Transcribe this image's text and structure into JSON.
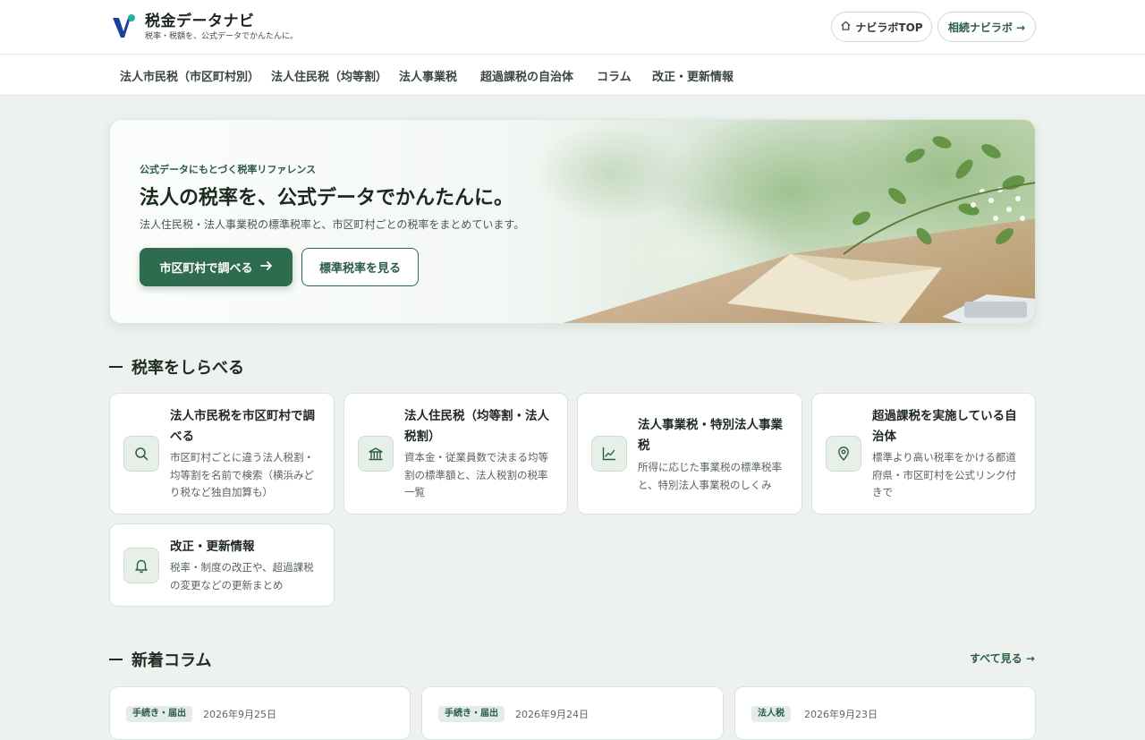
{
  "header": {
    "site_name": "税金データナビ",
    "tagline": "税率・税額を、公式データでかんたんに。",
    "top_link": "ナビラボTOP",
    "souzoku_link": "相続ナビラボ →"
  },
  "nav": {
    "items": [
      "法人市民税（市区町村別）",
      "法人住民税（均等割）",
      "法人事業税",
      "超過課税の自治体",
      "コラム",
      "改正・更新情報"
    ]
  },
  "hero": {
    "eyebrow": "公式データにもとづく税率リファレンス",
    "title": "法人の税率を、公式データでかんたんに。",
    "subtitle": "法人住民税・法人事業税の標準税率と、市区町村ごとの税率をまとめています。",
    "primary_button": "市区町村で調べる",
    "secondary_button": "標準税率を見る"
  },
  "lookup": {
    "section_title": "税率をしらべる",
    "cards": [
      {
        "title": "法人市民税を市区町村で調べる",
        "desc": "市区町村ごとに違う法人税割・均等割を名前で検索（横浜みどり税など独自加算も）",
        "icon": "search-icon"
      },
      {
        "title": "法人住民税（均等割・法人税割）",
        "desc": "資本金・従業員数で決まる均等割の標準額と、法人税割の税率一覧",
        "icon": "building-icon"
      },
      {
        "title": "法人事業税・特別法人事業税",
        "desc": "所得に応じた事業税の標準税率と、特別法人事業税のしくみ",
        "icon": "chart-line-icon"
      },
      {
        "title": "超過課税を実施している自治体",
        "desc": "標準より高い税率をかける都道府県・市区町村を公式リンク付きで",
        "icon": "map-pin-icon"
      },
      {
        "title": "改正・更新情報",
        "desc": "税率・制度の改正や、超過課税の変更などの更新まとめ",
        "icon": "bell-icon"
      }
    ]
  },
  "columns": {
    "section_title": "新着コラム",
    "see_all": "すべて見る →",
    "items": [
      {
        "tag": "手続き・届出",
        "date": "2026年9月25日"
      },
      {
        "tag": "手続き・届出",
        "date": "2026年9月24日"
      },
      {
        "tag": "法人税",
        "date": "2026年9月23日"
      }
    ]
  },
  "colors": {
    "brand_green": "#2f6b4f",
    "background": "#edf2ee",
    "logo_blue": "#1f3f9e",
    "logo_teal": "#1db39a"
  }
}
